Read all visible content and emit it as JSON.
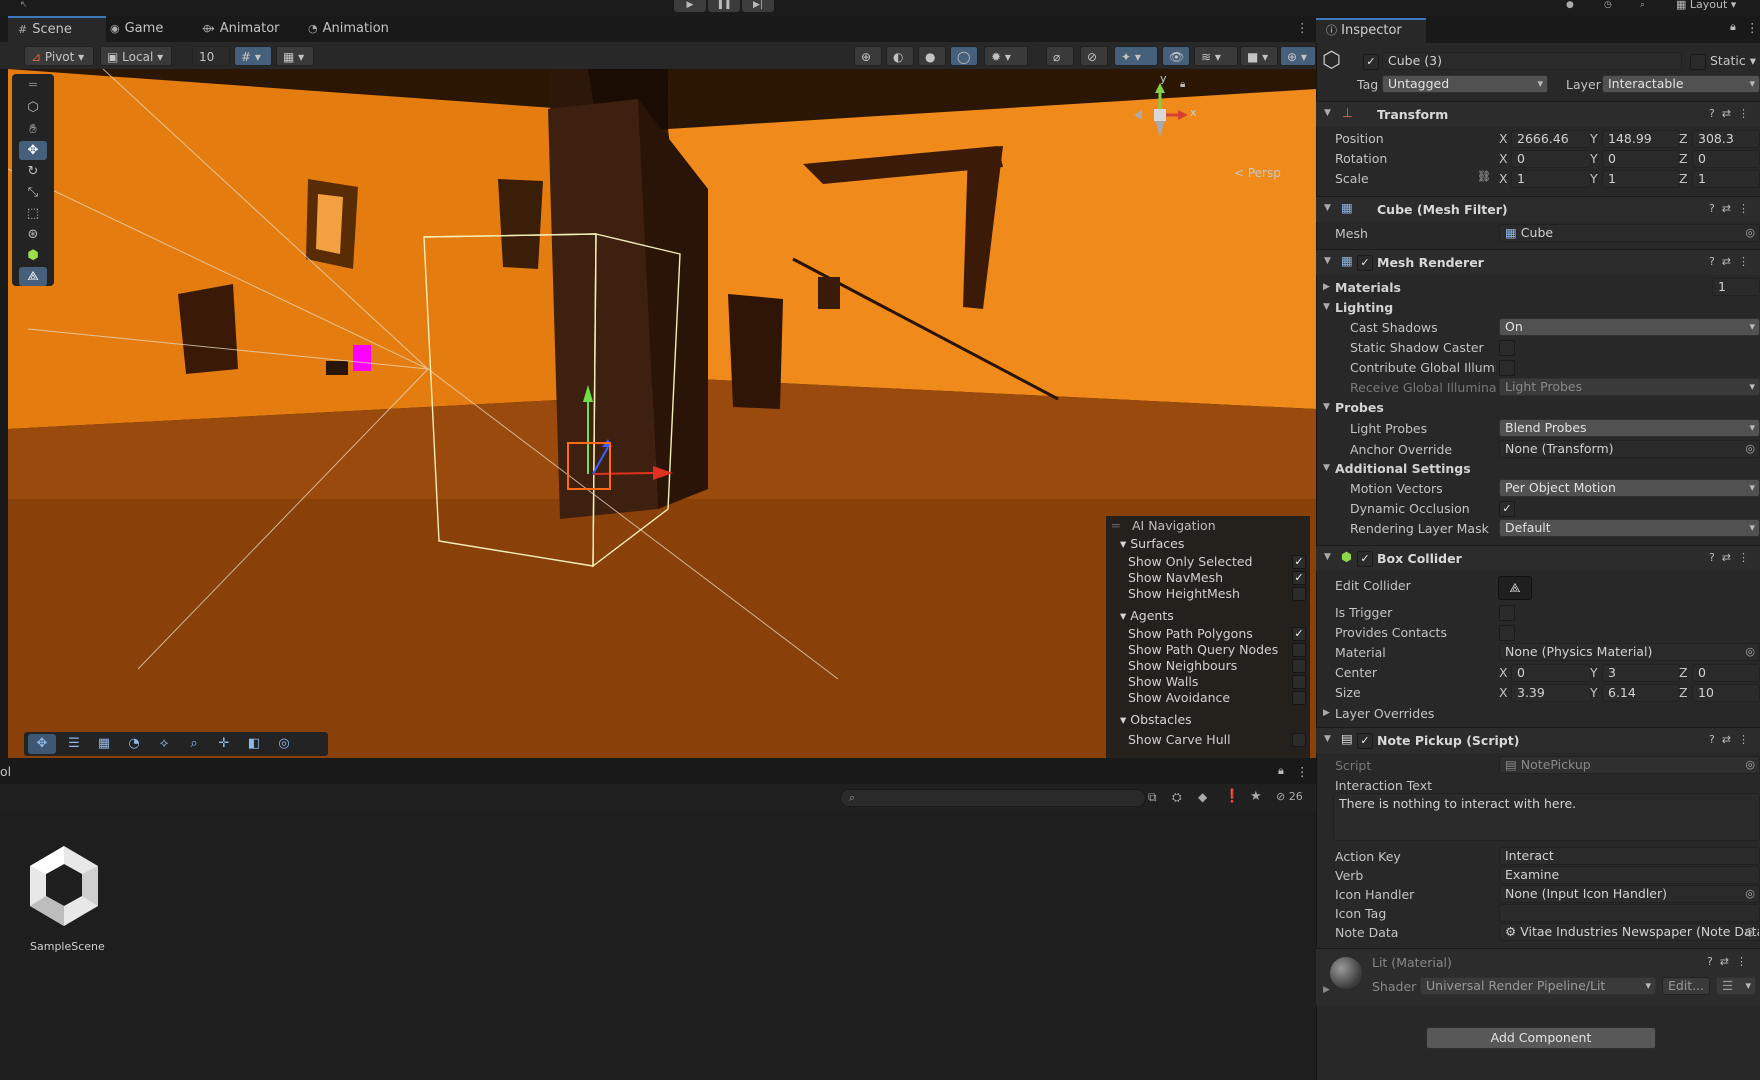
{
  "toolbar_top": {
    "layout_label": "Layout"
  },
  "scene_tabs": [
    {
      "label": "Scene",
      "icon": "grid-icon"
    },
    {
      "label": "Game",
      "icon": "gamepad-icon"
    },
    {
      "label": "Animator",
      "icon": "animator-icon"
    },
    {
      "label": "Animation",
      "icon": "clock-icon"
    }
  ],
  "scene_toolbar": {
    "pivot": "Pivot",
    "local": "Local",
    "grid_value": "10"
  },
  "gizmo": {
    "persp_label": "< Persp",
    "y": "y",
    "x": "x"
  },
  "ai_navigation": {
    "title": "AI Navigation",
    "groups": [
      {
        "label": "Surfaces",
        "items": [
          {
            "label": "Show Only Selected",
            "checked": true
          },
          {
            "label": "Show NavMesh",
            "checked": true
          },
          {
            "label": "Show HeightMesh",
            "checked": false
          }
        ]
      },
      {
        "label": "Agents",
        "items": [
          {
            "label": "Show Path Polygons",
            "checked": true
          },
          {
            "label": "Show Path Query Nodes",
            "checked": false
          },
          {
            "label": "Show Neighbours",
            "checked": false
          },
          {
            "label": "Show Walls",
            "checked": false
          },
          {
            "label": "Show Avoidance",
            "checked": false
          }
        ]
      },
      {
        "label": "Obstacles",
        "items": [
          {
            "label": "Show Carve Hull",
            "checked": false
          }
        ]
      }
    ]
  },
  "bottom_panel": {
    "tab_fragment": "ol",
    "badge_count": "26",
    "asset_name": "SampleScene"
  },
  "inspector": {
    "tab": "Inspector",
    "object_name": "Cube (3)",
    "static_label": "Static",
    "tag_label": "Tag",
    "tag_value": "Untagged",
    "layer_label": "Layer",
    "layer_value": "Interactable",
    "transform": {
      "title": "Transform",
      "position_label": "Position",
      "position": {
        "x": "2666.46",
        "y": "148.99",
        "z": "308.3"
      },
      "rotation_label": "Rotation",
      "rotation": {
        "x": "0",
        "y": "0",
        "z": "0"
      },
      "scale_label": "Scale",
      "scale": {
        "x": "1",
        "y": "1",
        "z": "1"
      }
    },
    "mesh_filter": {
      "title": "Cube (Mesh Filter)",
      "mesh_label": "Mesh",
      "mesh_value": "Cube"
    },
    "mesh_renderer": {
      "title": "Mesh Renderer",
      "materials_label": "Materials",
      "materials_count": "1",
      "lighting_label": "Lighting",
      "cast_shadows_label": "Cast Shadows",
      "cast_shadows": "On",
      "static_shadow_label": "Static Shadow Caster",
      "contribute_gi_label": "Contribute Global Illumina",
      "receive_gi_label": "Receive Global Illuminatic",
      "receive_gi": "Light Probes",
      "probes_label": "Probes",
      "light_probes_label": "Light Probes",
      "light_probes": "Blend Probes",
      "anchor_override_label": "Anchor Override",
      "anchor_override": "None (Transform)",
      "additional_label": "Additional Settings",
      "motion_vectors_label": "Motion Vectors",
      "motion_vectors": "Per Object Motion",
      "dynamic_occlusion_label": "Dynamic Occlusion",
      "rendering_layer_label": "Rendering Layer Mask",
      "rendering_layer": "Default"
    },
    "box_collider": {
      "title": "Box Collider",
      "edit_collider_label": "Edit Collider",
      "is_trigger_label": "Is Trigger",
      "provides_contacts_label": "Provides Contacts",
      "material_label": "Material",
      "material_value": "None (Physics Material)",
      "center_label": "Center",
      "center": {
        "x": "0",
        "y": "3",
        "z": "0"
      },
      "size_label": "Size",
      "size": {
        "x": "3.39",
        "y": "6.14",
        "z": "10"
      },
      "layer_overrides_label": "Layer Overrides"
    },
    "note_pickup": {
      "title": "Note Pickup (Script)",
      "script_label": "Script",
      "script_value": "NotePickup",
      "interaction_text_label": "Interaction Text",
      "interaction_text": "There is nothing to interact with here.",
      "action_key_label": "Action Key",
      "action_key": "Interact",
      "verb_label": "Verb",
      "verb": "Examine",
      "icon_handler_label": "Icon Handler",
      "icon_handler": "None (Input Icon Handler)",
      "icon_tag_label": "Icon Tag",
      "icon_tag": "",
      "note_data_label": "Note Data",
      "note_data": "Vitae Industries Newspaper (Note Data)"
    },
    "material": {
      "title": "Lit (Material)",
      "shader_label": "Shader",
      "shader_value": "Universal Render Pipeline/Lit",
      "edit_label": "Edit..."
    },
    "add_component": "Add Component"
  },
  "colors": {
    "accent": "#3a79bb",
    "scene_orange": "#f07d10",
    "magenta": "#ff00ff"
  }
}
